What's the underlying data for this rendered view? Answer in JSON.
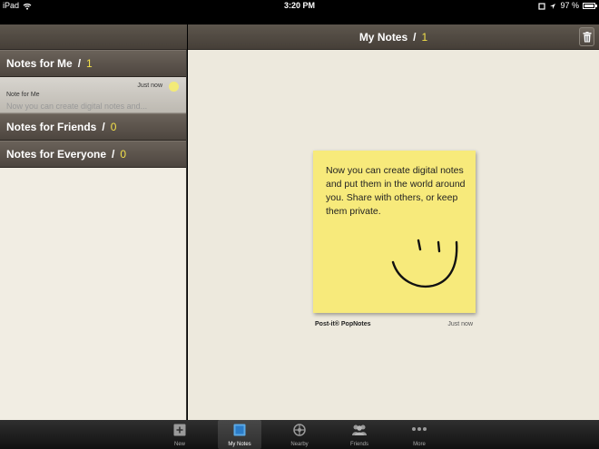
{
  "status": {
    "carrier": "iPad",
    "time": "3:20 PM",
    "battery_percent": "97 %",
    "battery_level": 0.97
  },
  "main": {
    "title": "My Notes",
    "separator": "/",
    "count": "1"
  },
  "sidebar": {
    "sections": [
      {
        "label": "Notes for Me",
        "separator": "/",
        "count": "1"
      },
      {
        "label": "Notes for Friends",
        "separator": "/",
        "count": "0"
      },
      {
        "label": "Notes for Everyone",
        "separator": "/",
        "count": "0"
      }
    ],
    "note_item": {
      "time": "Just now",
      "title": "Note for Me",
      "preview": "Now you can create digital notes and..."
    }
  },
  "note": {
    "text": "Now you can create digital notes and put them in the world around you. Share with others, or keep them private.",
    "brand": "Post-it® PopNotes",
    "time": "Just now",
    "color": "#f7ea7b"
  },
  "tabs": [
    {
      "label": "New",
      "icon": "new-note-icon"
    },
    {
      "label": "My Notes",
      "icon": "my-notes-icon",
      "active": true
    },
    {
      "label": "Nearby",
      "icon": "nearby-icon"
    },
    {
      "label": "Friends",
      "icon": "friends-icon"
    },
    {
      "label": "More",
      "icon": "more-icon"
    }
  ],
  "colors": {
    "accent": "#f2e04a",
    "bar": "#4d463f",
    "background": "#ede9dd"
  }
}
